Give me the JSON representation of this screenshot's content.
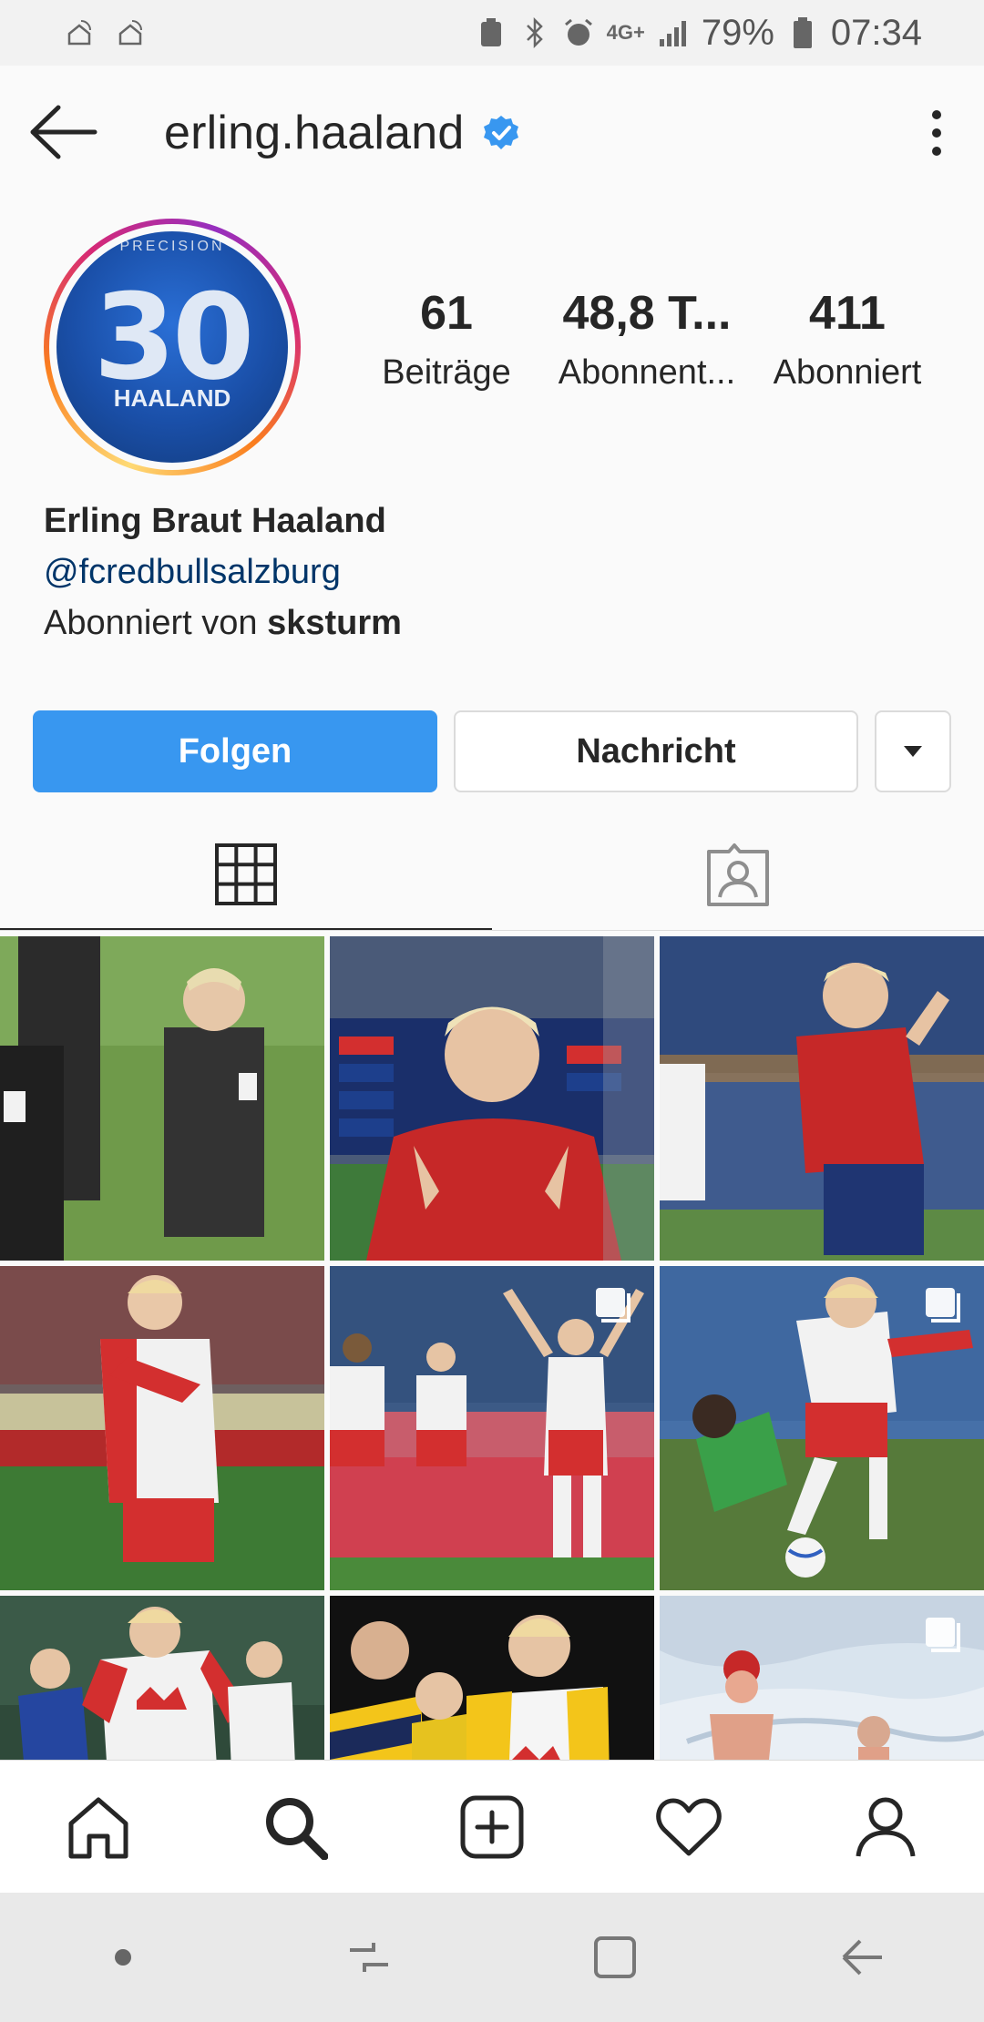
{
  "status_bar": {
    "battery": "79%",
    "time": "07:34",
    "network": "4G+"
  },
  "header": {
    "username": "erling.haaland"
  },
  "profile": {
    "avatar": {
      "jersey_number": "30",
      "jersey_name": "HAALAND"
    },
    "stats": [
      {
        "value": "61",
        "label": "Beiträge"
      },
      {
        "value": "48,8 T...",
        "label": "Abonnent..."
      },
      {
        "value": "411",
        "label": "Abonniert"
      }
    ],
    "full_name": "Erling Braut Haaland",
    "link": "@fcredbullsalzburg",
    "followed_by_prefix": "Abonniert von",
    "followed_by_user": "sksturm"
  },
  "actions": {
    "follow": "Folgen",
    "message": "Nachricht"
  },
  "colors": {
    "accent": "#3897f0",
    "verified": "#3897f0",
    "link": "#003569"
  },
  "tabs": [
    {
      "icon": "grid-icon",
      "active": true
    },
    {
      "icon": "tagged-icon",
      "active": false
    }
  ],
  "posts": [
    {
      "multi": false
    },
    {
      "multi": false
    },
    {
      "multi": false
    },
    {
      "multi": false
    },
    {
      "multi": true
    },
    {
      "multi": true
    },
    {
      "multi": false
    },
    {
      "multi": false
    },
    {
      "multi": true
    }
  ],
  "bottom_nav": [
    "home-icon",
    "search-icon",
    "add-post-icon",
    "activity-heart-icon",
    "profile-icon"
  ],
  "system_nav": [
    "dot-icon",
    "recent-apps-icon",
    "home-square-icon",
    "back-arrow-icon"
  ]
}
